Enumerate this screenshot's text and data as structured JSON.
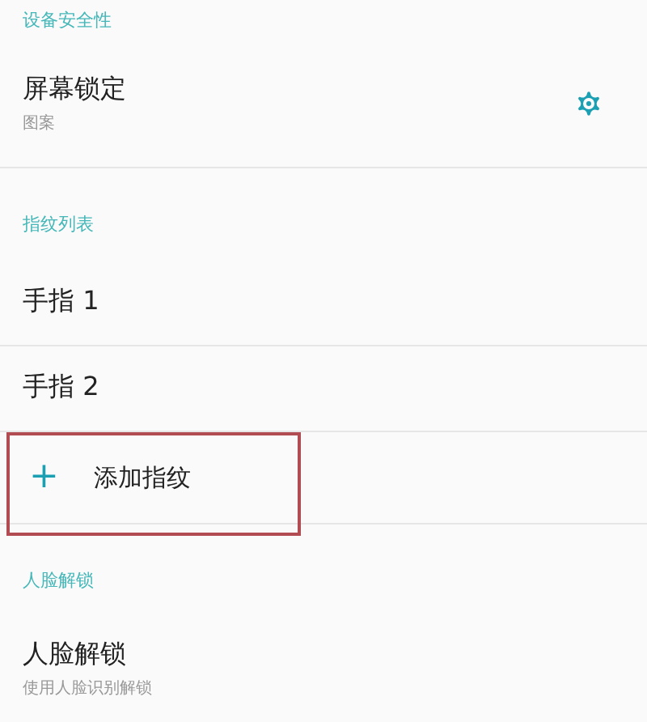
{
  "sections": [
    {
      "header": "设备安全性",
      "items": [
        {
          "kind": "setting",
          "title": "屏幕锁定",
          "subtitle": "图案",
          "gear": true
        }
      ]
    },
    {
      "header": "指纹列表",
      "items": [
        {
          "kind": "finger",
          "title": "手指 1"
        },
        {
          "kind": "finger",
          "title": "手指 2"
        },
        {
          "kind": "add",
          "icon": "+",
          "title": "添加指纹",
          "highlighted": true
        }
      ]
    },
    {
      "header": "人脸解锁",
      "items": [
        {
          "kind": "setting",
          "title": "人脸解锁",
          "subtitle": "使用人脸识别解锁",
          "gear": false
        }
      ]
    }
  ]
}
